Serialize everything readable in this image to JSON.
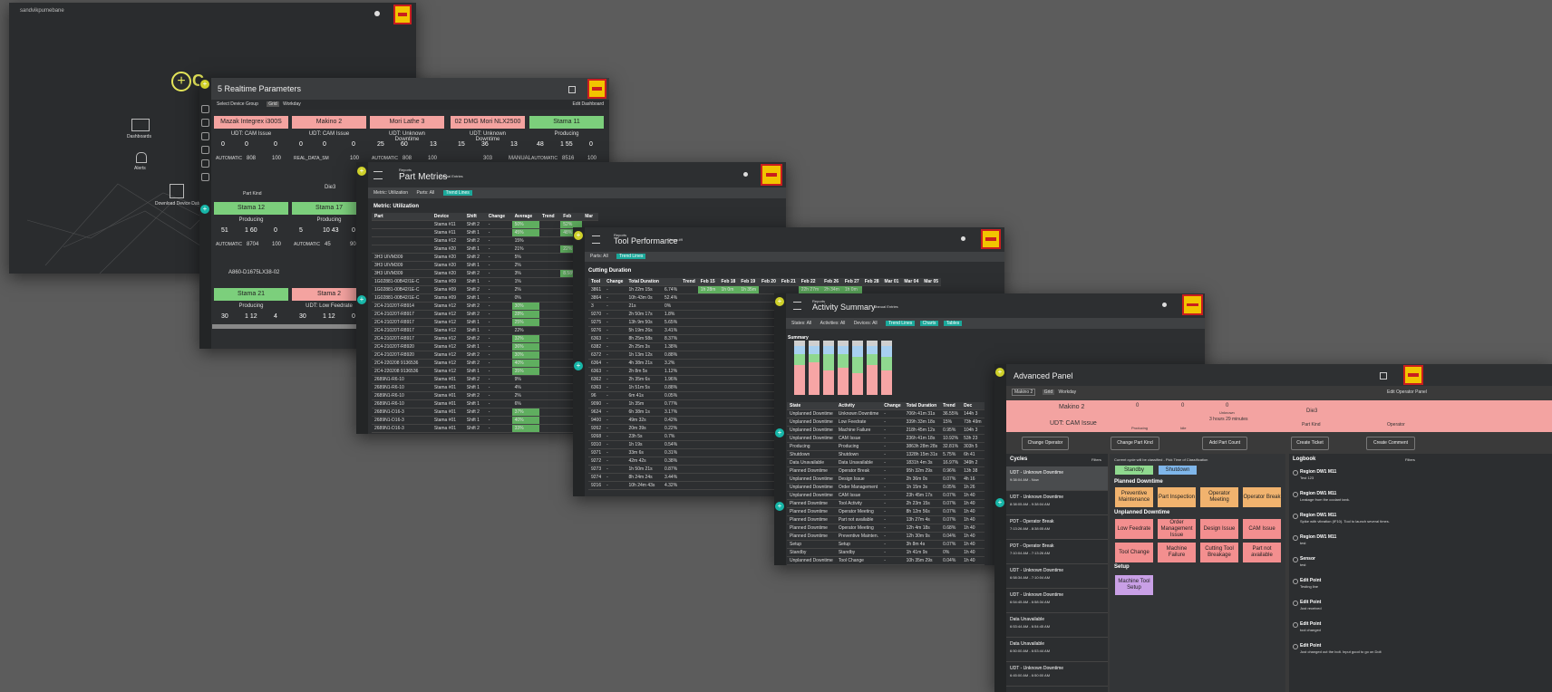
{
  "w1": {
    "user": "sandvikpumebane",
    "items": [
      "Dashboards",
      "Alerts",
      "Download Device Data"
    ],
    "brand": "C"
  },
  "w2": {
    "title": "5 Realtime Parameters",
    "toolbar": [
      "Select Device Group",
      "Grid",
      "Workday",
      "Edit Dashboard"
    ],
    "machines": [
      {
        "name": "Mazak Integrex i300S",
        "status": "UDT: CAM Issue",
        "state": "red",
        "v1": "0",
        "v2": "0",
        "v3": "0",
        "mode": "AUTOMATIC",
        "n1": "808",
        "n2": "100"
      },
      {
        "name": "Makino 2",
        "status": "UDT: CAM Issue",
        "state": "red",
        "v1": "0",
        "v2": "0",
        "v3": "0",
        "mode": "REAL_DATA_SM",
        "n1": "",
        "n2": "100"
      },
      {
        "name": "Mori Lathe 3",
        "status": "UDT: Unknown Downtime",
        "state": "red",
        "v1": "25",
        "v2": "60",
        "v3": "13",
        "mode": "AUTOMATIC",
        "n1": "808",
        "n2": "100"
      },
      {
        "name": "02 DMG Mori NLX2500",
        "status": "UDT: Unknown Downtime",
        "state": "red",
        "v1": "15",
        "v2": "36",
        "v3": "13",
        "mode": "",
        "n1": "303",
        "n2": "MANUAL"
      },
      {
        "name": "Stama 11",
        "status": "Producing",
        "state": "green",
        "v1": "48",
        "v2": "1 55",
        "v3": "0",
        "mode": "AUTOMATIC",
        "n1": "8516",
        "n2": "100"
      }
    ],
    "row2": [
      {
        "name": "Stama 12",
        "status": "Producing",
        "state": "green",
        "v1": "51",
        "v2": "1 60",
        "v3": "0",
        "mode": "AUTOMATIC",
        "n1": "8704",
        "n2": "100"
      },
      {
        "name": "Stama 17",
        "status": "Producing",
        "state": "green",
        "v1": "5",
        "v2": "10 43",
        "v3": "0",
        "mode": "AUTOMATIC",
        "n1": "45",
        "n2": "90"
      }
    ],
    "row3": [
      {
        "name": "Stama 21",
        "status": "Producing",
        "state": "green",
        "v1": "30",
        "v2": "1 12",
        "v3": "4"
      },
      {
        "name": "Stama 2",
        "status": "UDT: Low Feedrate",
        "state": "red",
        "v1": "30",
        "v2": "1 12",
        "v3": "0"
      }
    ],
    "part1": "Part Kind",
    "die": "Die3",
    "part2": "A860-D1675LX38-02"
  },
  "w3": {
    "crumb": "Reports",
    "title": "Part Metrics",
    "subtitle": "Manual Entries",
    "filters": [
      "Metric: Utilization",
      "Parts: All",
      "Trend Lines"
    ],
    "section": "Metric: Utilization",
    "headers": [
      "Part",
      "Device",
      "Shift",
      "Change",
      "Average",
      "Trend",
      "Feb",
      "Mar"
    ],
    "rows": [
      [
        "",
        "Stama #11",
        "Shift 2",
        "-",
        "50%",
        "",
        "52%",
        ""
      ],
      [
        "",
        "Stama #11",
        "Shift 1",
        "-",
        "45%",
        "",
        "48%",
        ""
      ],
      [
        "",
        "Stama #12",
        "Shift 2",
        "-",
        "15%",
        "",
        "",
        ""
      ],
      [
        "",
        "Stama #20",
        "Shift 1",
        "-",
        "21%",
        "",
        "22%",
        ""
      ],
      [
        "3H3 UIVM309",
        "Stama #20",
        "Shift 2",
        "-",
        "5%",
        "",
        "",
        ""
      ],
      [
        "3H3 UIVM309",
        "Stama #20",
        "Shift 1",
        "-",
        "2%",
        "",
        "",
        ""
      ],
      [
        "3H3 UIVM309",
        "Stama #20",
        "Shift 2",
        "-",
        "3%",
        "",
        "8.58%",
        ""
      ],
      [
        "1G02881-00B42/1E-C",
        "Stama #09",
        "Shift 1",
        "-",
        "1%",
        "",
        "",
        ""
      ],
      [
        "1G02881-00B42/1E-C",
        "Stama #09",
        "Shift 2",
        "-",
        "2%",
        "",
        "",
        ""
      ],
      [
        "1G02881-00B42/1E-C",
        "Stama #09",
        "Shift 1",
        "-",
        "0%",
        "",
        "",
        ""
      ],
      [
        "2C4-21020T-R8914",
        "Stama #12",
        "Shift 2",
        "-",
        "30%",
        "",
        "",
        ""
      ],
      [
        "2C4-21020T-R8917",
        "Stama #12",
        "Shift 2",
        "-",
        "28%",
        "",
        "",
        ""
      ],
      [
        "2C4-21020T-R8917",
        "Stama #12",
        "Shift 1",
        "-",
        "25%",
        "",
        "",
        ""
      ],
      [
        "2C4-21020T-R8917",
        "Stama #12",
        "Shift 1",
        "-",
        "22%",
        "",
        "",
        ""
      ],
      [
        "2C4-21020T-R8917",
        "Stama #12",
        "Shift 2",
        "-",
        "32%",
        "",
        "",
        ""
      ],
      [
        "2C4-21020T-R8920",
        "Stama #12",
        "Shift 1",
        "-",
        "36%",
        "",
        "",
        ""
      ],
      [
        "2C4-21020T-R8920",
        "Stama #12",
        "Shift 2",
        "-",
        "30%",
        "",
        "",
        ""
      ],
      [
        "2C4-220208 9136536",
        "Stama #12",
        "Shift 2",
        "-",
        "40%",
        "",
        "",
        ""
      ],
      [
        "2C4-220208 9136536",
        "Stama #12",
        "Shift 1",
        "-",
        "35%",
        "",
        "",
        ""
      ],
      [
        "2689N1-R6-10",
        "Stama #01",
        "Shift 2",
        "-",
        "9%",
        "",
        "",
        ""
      ],
      [
        "2689N1-R6-10",
        "Stama #01",
        "Shift 1",
        "-",
        "4%",
        "",
        "",
        ""
      ],
      [
        "2689N1-R6-10",
        "Stama #01",
        "Shift 2",
        "-",
        "2%",
        "",
        "",
        ""
      ],
      [
        "2689N1-R6-10",
        "Stama #01",
        "Shift 1",
        "-",
        "6%",
        "",
        "",
        ""
      ],
      [
        "2689N1-D16-3",
        "Stama #01",
        "Shift 2",
        "-",
        "37%",
        "",
        "",
        ""
      ],
      [
        "2689N1-D16-3",
        "Stama #01",
        "Shift 1",
        "-",
        "40%",
        "",
        "",
        ""
      ],
      [
        "2689N1-D16-3",
        "Stama #01",
        "Shift 2",
        "-",
        "33%",
        "",
        "",
        ""
      ]
    ]
  },
  "w4": {
    "crumb": "Reports",
    "title": "Tool Performance",
    "subtitle": "Stama #9",
    "filters": [
      "Parts: All",
      "Trend Lines"
    ],
    "section": "Cutting Duration",
    "headers": [
      "Tool",
      "Change",
      "Total Duration",
      "",
      "Trend",
      "Feb 15",
      "Feb 18",
      "Feb 19",
      "Feb 20",
      "Feb 21",
      "Feb 22",
      "Feb 26",
      "Feb 27",
      "Feb 28",
      "Mar 01",
      "Mar 04",
      "Mar 05"
    ],
    "rows": [
      [
        "3861",
        "-",
        "1h 22m 15s",
        "6.74%",
        "",
        "1h 28m",
        "1h 0m",
        "1h 35m",
        "",
        "",
        "22h 27m",
        "2h 34m",
        "1h 0m",
        "",
        "",
        "",
        ""
      ],
      [
        "3864",
        "-",
        "10h 43m 0s",
        "52.4%",
        "",
        "",
        "",
        "",
        "",
        "",
        "",
        "",
        "",
        "",
        "",
        "",
        ""
      ],
      [
        "3",
        "-",
        "21s",
        "0%",
        "",
        "",
        "",
        "",
        "",
        "",
        "",
        "",
        "",
        "",
        "",
        "",
        ""
      ],
      [
        "9270",
        "-",
        "2h 50m 17s",
        "1.8%",
        "",
        "",
        "",
        "",
        "",
        "",
        "",
        "",
        "",
        "",
        "",
        "",
        ""
      ],
      [
        "9275",
        "-",
        "13h 9m 50s",
        "5.65%",
        "",
        "",
        "",
        "",
        "",
        "",
        "",
        "",
        "",
        "",
        "",
        "",
        ""
      ],
      [
        "9276",
        "-",
        "5h 19m 26s",
        "3.41%",
        "",
        "",
        "",
        "",
        "",
        "",
        "",
        "",
        "",
        "",
        "",
        "",
        ""
      ],
      [
        "6363",
        "-",
        "8h 25m 58s",
        "8.37%",
        "",
        "",
        "",
        "",
        "",
        "",
        "",
        "",
        "",
        "",
        "",
        "",
        ""
      ],
      [
        "6382",
        "-",
        "2h 25m 3s",
        "1.38%",
        "",
        "",
        "",
        "",
        "",
        "",
        "",
        "",
        "",
        "",
        "",
        "",
        ""
      ],
      [
        "6372",
        "-",
        "1h 13m 12s",
        "0.88%",
        "",
        "",
        "",
        "",
        "",
        "",
        "",
        "",
        "",
        "",
        "",
        "",
        ""
      ],
      [
        "6364",
        "-",
        "4h 38m 21s",
        "3.2%",
        "",
        "",
        "",
        "",
        "",
        "",
        "",
        "",
        "",
        "",
        "",
        "",
        ""
      ],
      [
        "6363",
        "-",
        "2h 8m 5s",
        "1.12%",
        "",
        "",
        "",
        "",
        "",
        "",
        "",
        "",
        "",
        "",
        "",
        "",
        ""
      ],
      [
        "6362",
        "-",
        "2h 35m 6s",
        "1.96%",
        "",
        "",
        "",
        "",
        "",
        "",
        "",
        "",
        "",
        "",
        "",
        "",
        ""
      ],
      [
        "6363",
        "-",
        "1h 51m 5s",
        "0.88%",
        "",
        "",
        "",
        "",
        "",
        "",
        "",
        "",
        "",
        "",
        "",
        "",
        ""
      ],
      [
        "96",
        "-",
        "6m 41s",
        "0.05%",
        "",
        "",
        "",
        "",
        "",
        "",
        "",
        "",
        "",
        "",
        "",
        "",
        ""
      ],
      [
        "9090",
        "-",
        "1h 35m",
        "0.77%",
        "",
        "",
        "",
        "",
        "",
        "",
        "",
        "",
        "",
        "",
        "",
        "",
        ""
      ],
      [
        "9624",
        "-",
        "6h 38m 1s",
        "3.17%",
        "",
        "",
        "",
        "",
        "",
        "",
        "",
        "",
        "",
        "",
        "",
        "",
        ""
      ],
      [
        "9400",
        "-",
        "49m 32s",
        "0.42%",
        "",
        "",
        "",
        "",
        "",
        "",
        "",
        "",
        "",
        "",
        "",
        "",
        ""
      ],
      [
        "9262",
        "-",
        "20m 39s",
        "0.22%",
        "",
        "",
        "",
        "",
        "",
        "",
        "",
        "",
        "",
        "",
        "",
        "",
        ""
      ],
      [
        "9268",
        "-",
        "23h 5s",
        "0.7%",
        "",
        "",
        "",
        "",
        "",
        "",
        "",
        "",
        "",
        "",
        "",
        "",
        ""
      ],
      [
        "9310",
        "-",
        "1h 19s",
        "0.54%",
        "",
        "",
        "",
        "",
        "",
        "",
        "",
        "",
        "",
        "",
        "",
        "",
        ""
      ],
      [
        "9371",
        "-",
        "33m 6s",
        "0.31%",
        "",
        "",
        "",
        "",
        "",
        "",
        "",
        "",
        "",
        "",
        "",
        "",
        ""
      ],
      [
        "9272",
        "-",
        "42m 42s",
        "0.38%",
        "",
        "",
        "",
        "",
        "",
        "",
        "",
        "",
        "",
        "",
        "",
        "",
        ""
      ],
      [
        "9273",
        "-",
        "1h 50m 21s",
        "0.87%",
        "",
        "",
        "",
        "",
        "",
        "",
        "",
        "",
        "",
        "",
        "",
        "",
        ""
      ],
      [
        "9274",
        "-",
        "8h 24m 24s",
        "3.44%",
        "",
        "",
        "",
        "",
        "",
        "",
        "",
        "",
        "",
        "",
        "",
        "",
        ""
      ],
      [
        "9216",
        "-",
        "10h 24m 43s",
        "4.32%",
        "",
        "",
        "",
        "",
        "",
        "",
        "",
        "",
        "",
        "",
        "",
        "",
        ""
      ]
    ]
  },
  "w5": {
    "crumb": "Reports",
    "title": "Activity Summary",
    "subtitle": "Manual Entries",
    "filters": [
      "States: All",
      "Activities: All",
      "Devices: All",
      "Trend Lines",
      "Charts",
      "Tables"
    ],
    "section": "Summary",
    "headers": [
      "State",
      "Activity",
      "Change",
      "Total Duration",
      "Trend",
      "Dec"
    ],
    "rows": [
      [
        "Unplanned Downtime",
        "Unknown Downtime",
        "-",
        "706h 41m 31s",
        "36.55%",
        "144h 3"
      ],
      [
        "Unplanned Downtime",
        "Low Feedrate",
        "-",
        "339h 33m 18s",
        "15%",
        "73h 49m"
      ],
      [
        "Unplanned Downtime",
        "Machine Failure",
        "-",
        "218h 45m 12s",
        "0.95%",
        "104h 3"
      ],
      [
        "Unplanned Downtime",
        "CAM Issue",
        "-",
        "236h 41m 18s",
        "10.92%",
        "53h 23"
      ],
      [
        "Producing",
        "Producing",
        "-",
        "3863h 28m 28s",
        "32.81%",
        "303h 5"
      ],
      [
        "Shutdown",
        "Shutdown",
        "-",
        "1328h 15m 31s",
        "5.75%",
        "6h 41"
      ],
      [
        "Data Unavailable",
        "Data Unavailable",
        "-",
        "1831h 4m 3s",
        "16.97%",
        "349h 2"
      ],
      [
        "Planned Downtime",
        "Operator Break",
        "-",
        "95h 32m 29s",
        "0.96%",
        "13h 38"
      ],
      [
        "Unplanned Downtime",
        "Design Issue",
        "-",
        "2h 36m 0s",
        "0.07%",
        "4h 16"
      ],
      [
        "Unplanned Downtime",
        "Order Management",
        "-",
        "1h 15m 3s",
        "0.05%",
        "1h 26"
      ],
      [
        "Unplanned Downtime",
        "CAM Issue",
        "-",
        "23h 45m 17s",
        "0.07%",
        "1h 40"
      ],
      [
        "Planned Downtime",
        "Tool Activity",
        "-",
        "2h 23m 15s",
        "0.07%",
        "1h 40"
      ],
      [
        "Planned Downtime",
        "Operator Meeting",
        "-",
        "8h 12m 56s",
        "0.07%",
        "1h 40"
      ],
      [
        "Planned Downtime",
        "Part not available",
        "-",
        "13h 27m 4s",
        "0.07%",
        "1h 40"
      ],
      [
        "Planned Downtime",
        "Operator Meeting",
        "-",
        "12h 4m 18s",
        "0.68%",
        "1h 40"
      ],
      [
        "Planned Downtime",
        "Preventive Mainten.",
        "-",
        "12h 30m 9s",
        "0.04%",
        "1h 40"
      ],
      [
        "Setup",
        "Setup",
        "-",
        "3h 8m 4s",
        "0.07%",
        "1h 40"
      ],
      [
        "Standby",
        "Standby",
        "-",
        "1h 41m 9s",
        "0%",
        "1h 40"
      ],
      [
        "Unplanned Downtime",
        "Tool Change",
        "-",
        "10h 35m 29s",
        "0.04%",
        "1h 40"
      ],
      [
        "Planned Downtime",
        "Part Inspection",
        "-",
        "2h 28m 41s",
        "0%",
        "1h 40"
      ]
    ],
    "bars": [
      [
        0.55,
        0.2,
        0.15,
        0.1
      ],
      [
        0.6,
        0.15,
        0.15,
        0.1
      ],
      [
        0.45,
        0.3,
        0.15,
        0.1
      ],
      [
        0.5,
        0.25,
        0.15,
        0.1
      ],
      [
        0.4,
        0.3,
        0.2,
        0.1
      ],
      [
        0.55,
        0.2,
        0.15,
        0.1
      ],
      [
        0.45,
        0.25,
        0.2,
        0.1
      ]
    ],
    "bar_colors": [
      "#f6a5a5",
      "#8fd88f",
      "#a8d0f0",
      "#cfcfcf"
    ]
  },
  "w6": {
    "title": "Advanced Panel",
    "toolbar": [
      "Makino 2",
      "Grid",
      "Workday",
      "Edit Operator Panel"
    ],
    "machine": "Makino 2",
    "status": "UDT: CAM Issue",
    "stats": [
      {
        "v": "0",
        "l": "Producing"
      },
      {
        "v": "0",
        "l": "Idle"
      },
      {
        "v": "0",
        "l": "Unknown"
      }
    ],
    "since": "3 hours 29 minutes",
    "die": "Die3",
    "partkind": "Part Kind",
    "operator": "Operator",
    "actions": [
      "Change Operator",
      "Change Part Kind",
      "Add Part Count",
      "Create Ticket",
      "Create Comment"
    ],
    "cycles_title": "Cycles",
    "filters": "Filters",
    "cycles": [
      {
        "t": "UDT - Unknown Downtime",
        "d": "9:38:04 AM - Now"
      },
      {
        "t": "UDT - Unknown Downtime",
        "d": "8:38:05 AM - 9:38:04 AM"
      },
      {
        "t": "PDT - Operator Break",
        "d": "7:13:26 AM - 8:38:05 AM"
      },
      {
        "t": "PDT - Operator Break",
        "d": "7:10:04 AM - 7:13:26 AM"
      },
      {
        "t": "UDT - Unknown Downtime",
        "d": "6:58:34 AM - 7:10:04 AM"
      },
      {
        "t": "UDT - Unknown Downtime",
        "d": "6:54:45 AM - 6:58:34 AM"
      },
      {
        "t": "Data Unavailable",
        "d": "6:53:44 AM - 6:54:45 AM"
      },
      {
        "t": "Data Unavailable",
        "d": "6:50:00 AM - 6:53:44 AM"
      },
      {
        "t": "UDT - Unknown Downtime",
        "d": "6:45:00 AM - 6:50:00 AM"
      }
    ],
    "current_note": "Current cycle will be classified - Pick Time of Classification",
    "standby": "Standby",
    "shutdown": "Shutdown",
    "planned_title": "Planned Downtime",
    "planned": [
      "Preventive Maintenance",
      "Part Inspection",
      "Operator Meeting",
      "Operator Break"
    ],
    "unplanned_title": "Unplanned Downtime",
    "unplanned": [
      "Low Feedrate",
      "Order Management Issue",
      "Design Issue",
      "CAM Issue",
      "Tool Change",
      "Machine Failure",
      "Cutting Tool Breakage",
      "Part not available"
    ],
    "setup_title": "Setup",
    "setup": [
      "Machine Tool Setup"
    ],
    "logbook_title": "Logbook",
    "logbook": [
      {
        "t": "Region DW1 M11",
        "b": "Test 123"
      },
      {
        "t": "Region DW1 M11",
        "b": "Leakage from the coolant tank."
      },
      {
        "t": "Region DW1 M11",
        "b": "Spike with vibration (IF10). Tool to launch several times."
      },
      {
        "t": "Region DW1 M11",
        "b": "test"
      },
      {
        "t": "Sensor",
        "b": "test"
      },
      {
        "t": "Edit Point",
        "b": "Testing line"
      },
      {
        "t": "Edit Point",
        "b": "Just received"
      },
      {
        "t": "Edit Point",
        "b": "tool changed"
      },
      {
        "t": "Edit Point",
        "b": "Just changed out the bolt. Input good to go on Dolt"
      }
    ]
  }
}
